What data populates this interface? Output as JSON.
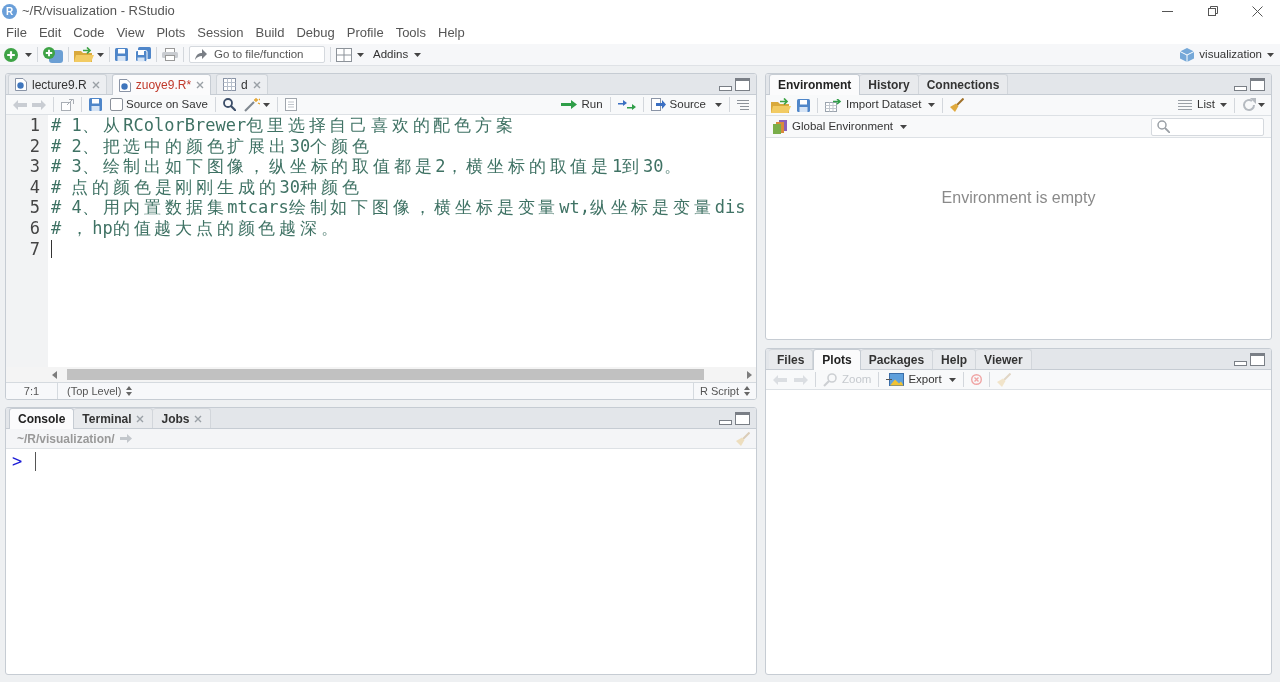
{
  "window": {
    "icon_text": "R",
    "title": "~/R/visualization - RStudio"
  },
  "menu": [
    "File",
    "Edit",
    "Code",
    "View",
    "Plots",
    "Session",
    "Build",
    "Debug",
    "Profile",
    "Tools",
    "Help"
  ],
  "toolbar": {
    "goto": {
      "placeholder": "Go to file/function"
    },
    "addins": "Addins",
    "project": "visualization"
  },
  "editor": {
    "tabs": [
      {
        "label": "lecture9.R",
        "kind": "script",
        "selected": false,
        "modified": false
      },
      {
        "label": "zuoye9.R*",
        "kind": "script",
        "selected": true,
        "modified": true
      },
      {
        "label": "d",
        "kind": "data",
        "selected": false,
        "modified": false
      }
    ],
    "source_on_save": {
      "label": "Source on Save",
      "checked": false
    },
    "run": "Run",
    "source": "Source",
    "lines": [
      {
        "number": "1",
        "text": "# 1、从RColorBrewer包里选择自己喜欢的配色方案",
        "cursor": false
      },
      {
        "number": "2",
        "text": "# 2、把选中的颜色扩展出30个颜色",
        "cursor": false
      },
      {
        "number": "3",
        "text": "# 3、绘制出如下图像，纵坐标的取值都是2，横坐标的取值是1到30。",
        "cursor": false
      },
      {
        "number": "4",
        "text": "# 点的颜色是刚刚生成的30种颜色",
        "cursor": false
      },
      {
        "number": "5",
        "text": "# 4、用内置数据集mtcars绘制如下图像，横坐标是变量wt,纵坐标是变量dis",
        "cursor": false
      },
      {
        "number": "6",
        "text": "# ，hp的值越大点的颜色越深。",
        "cursor": false
      },
      {
        "number": "7",
        "cursor": true
      }
    ],
    "status": {
      "position": "7:1",
      "scope": "(Top Level)",
      "file_type": "R Script"
    }
  },
  "console": {
    "tabs": [
      {
        "label": "Console",
        "selected": true,
        "closable": false
      },
      {
        "label": "Terminal",
        "selected": false,
        "closable": true
      },
      {
        "label": "Jobs",
        "selected": false,
        "closable": true
      }
    ],
    "path": "~/R/visualization/",
    "prompt": ">"
  },
  "environment": {
    "tabs": [
      {
        "label": "Environment",
        "selected": true
      },
      {
        "label": "History",
        "selected": false
      },
      {
        "label": "Connections",
        "selected": false
      }
    ],
    "import_dataset": "Import Dataset",
    "view_mode": "List",
    "scope": "Global Environment",
    "message": "Environment is empty"
  },
  "files": {
    "tabs": [
      {
        "label": "Files",
        "selected": false
      },
      {
        "label": "Plots",
        "selected": true
      },
      {
        "label": "Packages",
        "selected": false
      },
      {
        "label": "Help",
        "selected": false
      },
      {
        "label": "Viewer",
        "selected": false
      }
    ],
    "zoom": {
      "label": "Zoom",
      "disabled": true
    },
    "export": {
      "label": "Export",
      "disabled": false
    }
  }
}
